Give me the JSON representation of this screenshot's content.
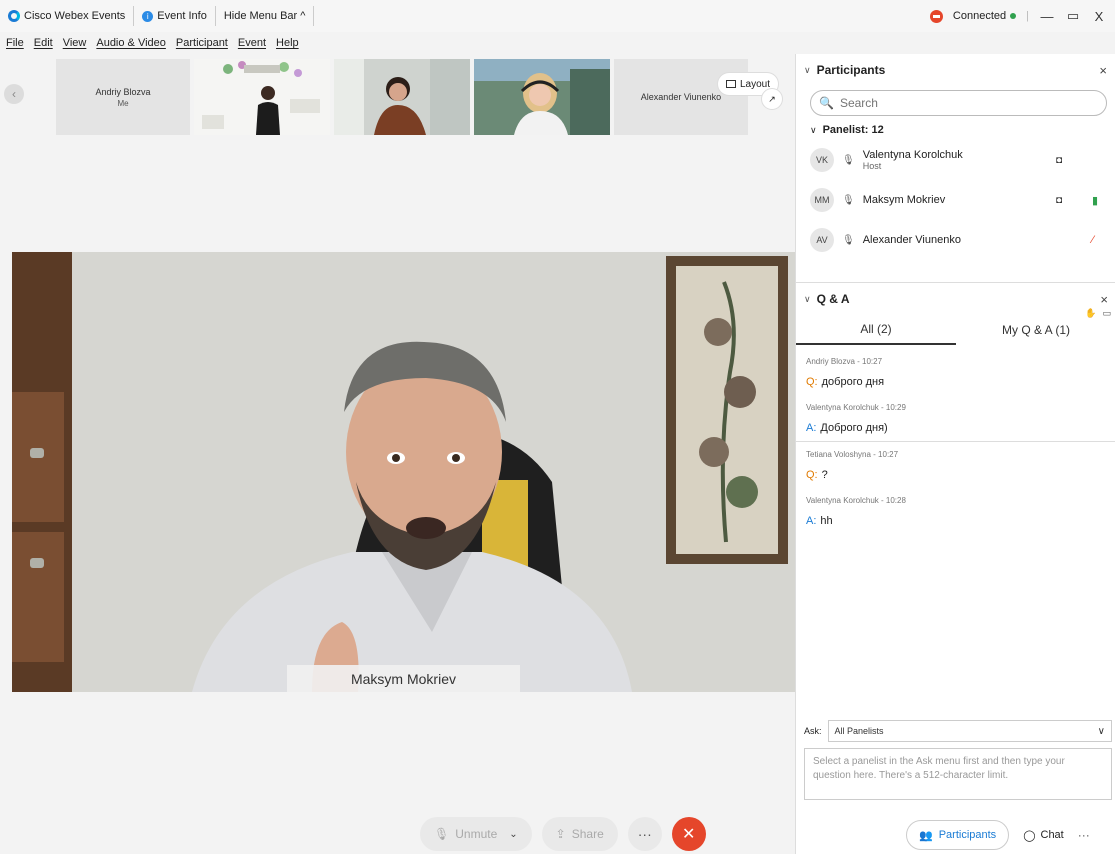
{
  "titlebar": {
    "app_name": "Cisco Webex Events",
    "event_info": "Event Info",
    "hide_menu": "Hide Menu Bar ^",
    "status": "Connected",
    "minimize": "—",
    "restore": "▭",
    "close": "X"
  },
  "menu": [
    "File",
    "Edit",
    "View",
    "Audio & Video",
    "Participant",
    "Event",
    "Help"
  ],
  "filmstrip": {
    "tile1_name": "Andriy Blozva",
    "tile1_sub": "Me",
    "tile5_name": "Alexander Viunenko",
    "layout_label": "Layout"
  },
  "main_video": {
    "name": "Maksym Mokriev"
  },
  "controls": {
    "unmute": "Unmute",
    "share": "Share",
    "more": "···",
    "end": "✕"
  },
  "participants": {
    "title": "Participants",
    "search_placeholder": "Search",
    "panelist_count": "Panelist: 12",
    "rows": [
      {
        "initials": "VK",
        "name": "Valentyna Korolchuk",
        "role": "Host"
      },
      {
        "initials": "MM",
        "name": "Maksym Mokriev",
        "role": ""
      },
      {
        "initials": "AV",
        "name": "Alexander Viunenko",
        "role": ""
      }
    ]
  },
  "qa": {
    "title": "Q & A",
    "tabs": [
      "All (2)",
      "My Q & A (1)"
    ],
    "items": [
      {
        "meta": "Andriy Blozva - 10:27",
        "type": "Q:",
        "text": "доброго дня"
      },
      {
        "meta": "Valentyna Korolchuk - 10:29",
        "type": "A:",
        "text": "Доброго дня)"
      },
      {
        "meta": "Tetiana Voloshyna - 10:27",
        "type": "Q:",
        "text": "?"
      },
      {
        "meta": "Valentyna Korolchuk - 10:28",
        "type": "A:",
        "text": "hh"
      }
    ],
    "ask_label": "Ask:",
    "ask_value": "All Panelists",
    "input_placeholder": "Select a panelist in the Ask menu first and then type your question here. There's a 512-character limit."
  },
  "bottom": {
    "participants": "Participants",
    "chat": "Chat",
    "more": "···"
  }
}
